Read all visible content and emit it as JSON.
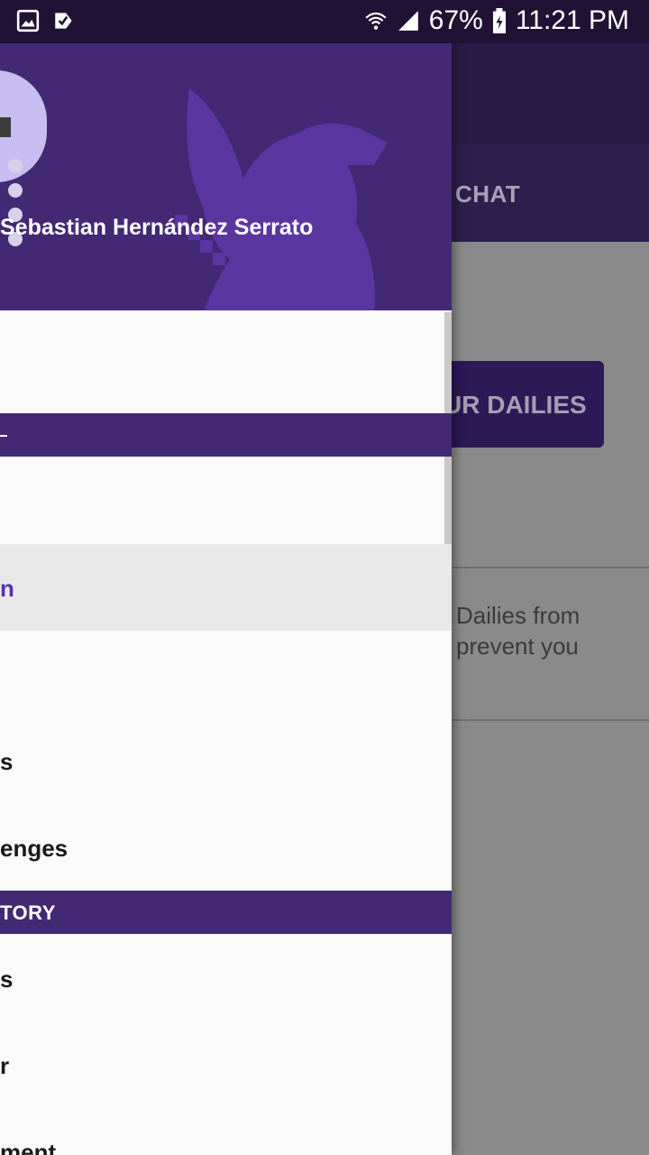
{
  "status_bar": {
    "battery": "67%",
    "time": "11:21 PM"
  },
  "background": {
    "tab_chat": "CHAT",
    "button_label": "UR DAILIES",
    "description_line1": "Dailies from",
    "description_line2": "prevent you"
  },
  "drawer": {
    "user": {
      "name": "Sebastian Hernández Serrato"
    },
    "sections": [
      {
        "label": ""
      },
      {
        "label": "TORY"
      }
    ],
    "items": [
      {
        "label": ""
      },
      {
        "label": ""
      },
      {
        "label": "n",
        "selected": true
      },
      {
        "label": ""
      },
      {
        "label": "s"
      },
      {
        "label": "enges"
      },
      {
        "label": "s"
      },
      {
        "label": "r"
      },
      {
        "label": "ment"
      }
    ]
  },
  "colors": {
    "primary": "#432874",
    "accent": "#5b2fb4",
    "status_bar": "#1f1235"
  }
}
